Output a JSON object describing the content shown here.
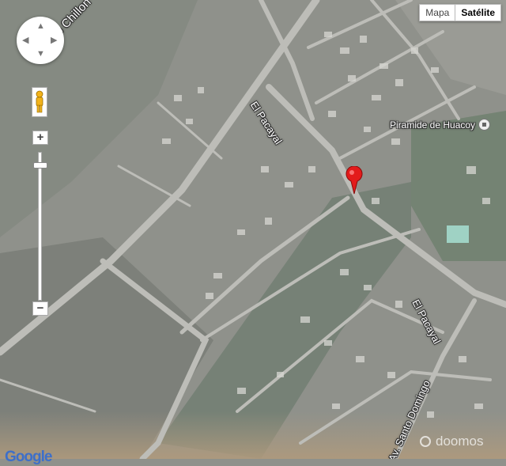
{
  "map": {
    "type_buttons": {
      "map": "Mapa",
      "satellite": "Satélite",
      "active": "satellite"
    },
    "labels": {
      "river": "Rio Chillon",
      "street_upper": "El Pacayal",
      "street_lower": "El Pacayal",
      "avenue": "Av. Santo Domingo"
    },
    "poi": {
      "name": "Piramide de Huacoy",
      "icon": "landmark-icon"
    },
    "marker": {
      "color": "#e31b1b",
      "icon": "location-pin-icon"
    },
    "zoom": {
      "plus": "+",
      "minus": "−"
    },
    "pan_arrows": {
      "up": "▲",
      "down": "▼",
      "left": "◀",
      "right": "▶"
    },
    "logo": "Google",
    "watermark": "doomos",
    "colors": {
      "imagery_base": "#8f918b",
      "road": "#bdbdb8",
      "vegetation": "#6f7d70",
      "desert": "#a99a82"
    }
  }
}
